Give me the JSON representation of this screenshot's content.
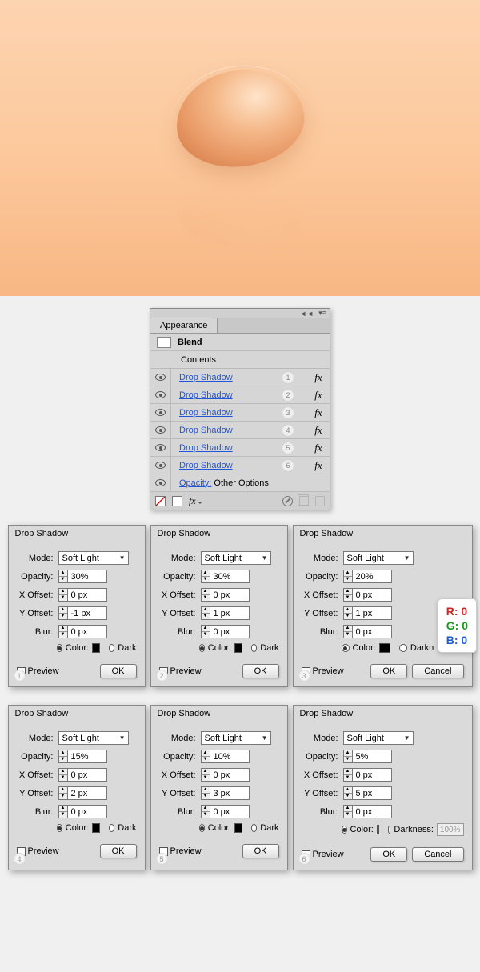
{
  "appearance": {
    "tab": "Appearance",
    "blend": "Blend",
    "contents": "Contents",
    "effect": "Drop Shadow",
    "opacity_lbl": "Opacity:",
    "other_options": "Other Options",
    "fx": "fx",
    "badges": [
      "1",
      "2",
      "3",
      "4",
      "5",
      "6"
    ]
  },
  "labels": {
    "ds_title": "Drop Shadow",
    "mode": "Mode:",
    "opacity": "Opacity:",
    "xoff": "X Offset:",
    "yoff": "Y Offset:",
    "blur": "Blur:",
    "color": "Color:",
    "darkness": "Darkness:",
    "preview": "Preview",
    "ok": "OK",
    "cancel": "Cancel",
    "mode_val": "Soft Light"
  },
  "rgb": {
    "r": "R: 0",
    "g": "G: 0",
    "b": "B: 0"
  },
  "dialogs": [
    {
      "num": "1",
      "opacity": "30%",
      "xoff": "0 px",
      "yoff": "-1 px",
      "blur": "0 px",
      "darkness": "Dark",
      "wide": false
    },
    {
      "num": "2",
      "opacity": "30%",
      "xoff": "0 px",
      "yoff": "1 px",
      "blur": "0 px",
      "darkness": "Dark",
      "wide": false
    },
    {
      "num": "3",
      "opacity": "20%",
      "xoff": "0 px",
      "yoff": "1 px",
      "blur": "0 px",
      "darkness": "Darkn",
      "wide": true
    },
    {
      "num": "4",
      "opacity": "15%",
      "xoff": "0 px",
      "yoff": "2 px",
      "blur": "0 px",
      "darkness": "Dark",
      "wide": false
    },
    {
      "num": "5",
      "opacity": "10%",
      "xoff": "0 px",
      "yoff": "3 px",
      "blur": "0 px",
      "darkness": "Dark",
      "wide": false
    },
    {
      "num": "6",
      "opacity": "5%",
      "xoff": "0 px",
      "yoff": "5 px",
      "blur": "0 px",
      "darkness": "Darkness:",
      "wide": true,
      "darkness_val": "100%"
    }
  ]
}
